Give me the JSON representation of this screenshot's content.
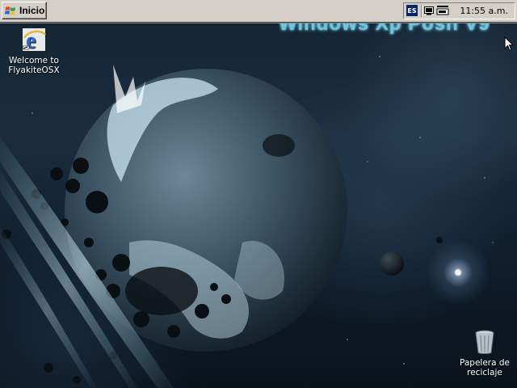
{
  "taskbar": {
    "start_label": "Inicio",
    "language": "ES",
    "clock": "11:55 a.m."
  },
  "wallpaper": {
    "title": "Windows Xp Posh V9"
  },
  "desktop_icons": [
    {
      "label": "Welcome to FlyakiteOSX",
      "icon": "internet-explorer-icon"
    },
    {
      "label": "Papelera de reciclaje",
      "icon": "recycle-bin-icon"
    }
  ],
  "colors": {
    "taskbar_face": "#d4d0c8",
    "title_glow": "#6ec6dd",
    "desktop_bg": "#142331"
  }
}
